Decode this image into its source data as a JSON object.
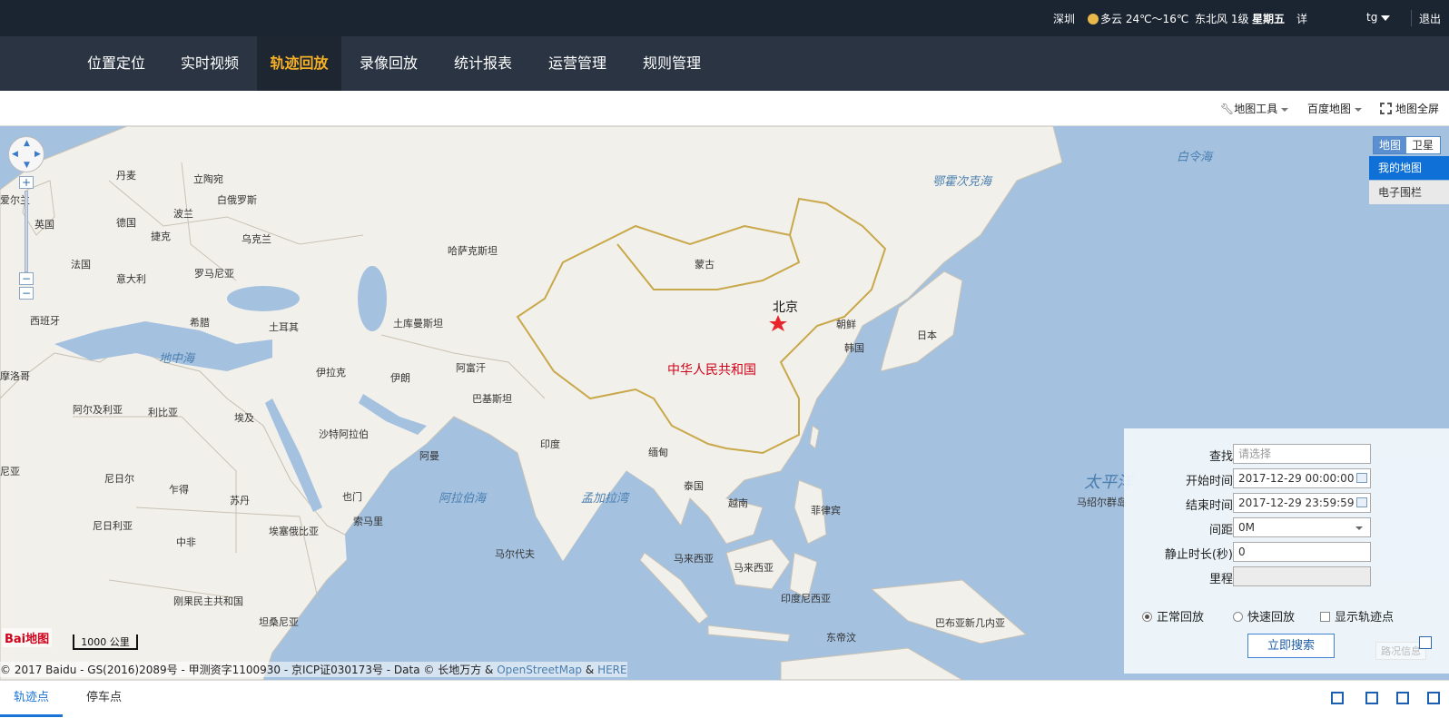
{
  "topbar": {
    "city": "深圳",
    "weather": "多云 24℃～16℃",
    "wind": "东北风 1级",
    "weekday": "星期五",
    "detail": "详",
    "user": "tg",
    "logout": "退出"
  },
  "nav": {
    "items": [
      {
        "label": "位置定位"
      },
      {
        "label": "实时视频"
      },
      {
        "label": "轨迹回放"
      },
      {
        "label": "录像回放"
      },
      {
        "label": "统计报表"
      },
      {
        "label": "运营管理"
      },
      {
        "label": "规则管理"
      }
    ],
    "active": "轨迹回放"
  },
  "toolbar": {
    "map_tools": "地图工具",
    "baidu_map": "百度地图",
    "fullscreen": "地图全屏"
  },
  "map": {
    "type_map": "地图",
    "type_satellite": "卫星",
    "my_map": "我的地图",
    "e_fence": "电子围栏",
    "labels": {
      "china": "中华人民共和国",
      "beijing": "北京",
      "mongolia": "蒙古",
      "kazakhstan": "哈萨克斯坦",
      "turkmenistan": "土库曼斯坦",
      "iran": "伊朗",
      "iraq": "伊拉克",
      "afghanistan": "阿富汗",
      "pakistan": "巴基斯坦",
      "india": "印度",
      "myanmar": "缅甸",
      "thailand": "泰国",
      "vietnam": "越南",
      "philippines": "菲律宾",
      "malaysia1": "马来西亚",
      "malaysia2": "马来西亚",
      "indonesia": "印度尼西亚",
      "timor": "东帝汶",
      "png": "巴布亚新几内亚",
      "japan": "日本",
      "korea_n": "朝鲜",
      "korea_s": "韩国",
      "turkey": "土耳其",
      "saudi": "沙特阿拉伯",
      "oman": "阿曼",
      "yemen": "也门",
      "somalia": "索马里",
      "ethiopia": "埃塞俄比亚",
      "sudan": "苏丹",
      "egypt": "埃及",
      "libya": "利比亚",
      "algeria": "阿尔及利亚",
      "chad": "乍得",
      "niger": "尼日尔",
      "nigeria": "尼日利亚",
      "car": "中非",
      "drc": "刚果民主共和国",
      "tanzania": "坦桑尼亚",
      "maldives": "马尔代夫",
      "spain": "西班牙",
      "france": "法国",
      "italy": "意大利",
      "greece": "希腊",
      "romania": "罗马尼亚",
      "ukraine": "乌克兰",
      "poland": "波兰",
      "germany": "德国",
      "czech": "捷克",
      "uk": "英国",
      "ireland": "爱尔兰",
      "denmark": "丹麦",
      "lithuania": "立陶宛",
      "belarus": "白俄罗斯",
      "morocco": "摩洛哥",
      "mauritania": "尼亚",
      "marshall": "马绍尔群岛",
      "med": "地中海",
      "arabian": "阿拉伯海",
      "bengal": "孟加拉湾",
      "okhotsk": "鄂霍次克海",
      "bering": "白令海",
      "pacific": "太平洋"
    },
    "baidu_logo": "Bai地图",
    "scale": "1000 公里",
    "copyright_prefix": "© 2017 Baidu - GS(2016)2089号 - 甲测资字1100930 - 京ICP证030173号 - Data © 长地万方 &",
    "osm": "OpenStreetMap",
    "and": "&",
    "here": "HERE",
    "road_info": "路况信息"
  },
  "panel": {
    "find_label": "查找",
    "find_placeholder": "请选择",
    "start_label": "开始时间",
    "start_value": "2017-12-29 00:00:00",
    "end_label": "结束时间",
    "end_value": "2017-12-29 23:59:59",
    "interval_label": "间距",
    "interval_value": "0M",
    "stop_label": "静止时长(秒)",
    "stop_value": "0",
    "mileage_label": "里程",
    "mileage_value": "",
    "normal_play": "正常回放",
    "fast_play": "快速回放",
    "show_points": "显示轨迹点",
    "search_btn": "立即搜索"
  },
  "bottom": {
    "tab_track": "轨迹点",
    "tab_parking": "停车点"
  },
  "colors": {
    "topbar": "#1b2532",
    "nav": "#2a3442",
    "nav_active_text": "#f5b026",
    "sea": "#a4c1df",
    "land": "#f2f0ea",
    "china_border": "#c8a84a",
    "accent": "#1a73d8"
  }
}
